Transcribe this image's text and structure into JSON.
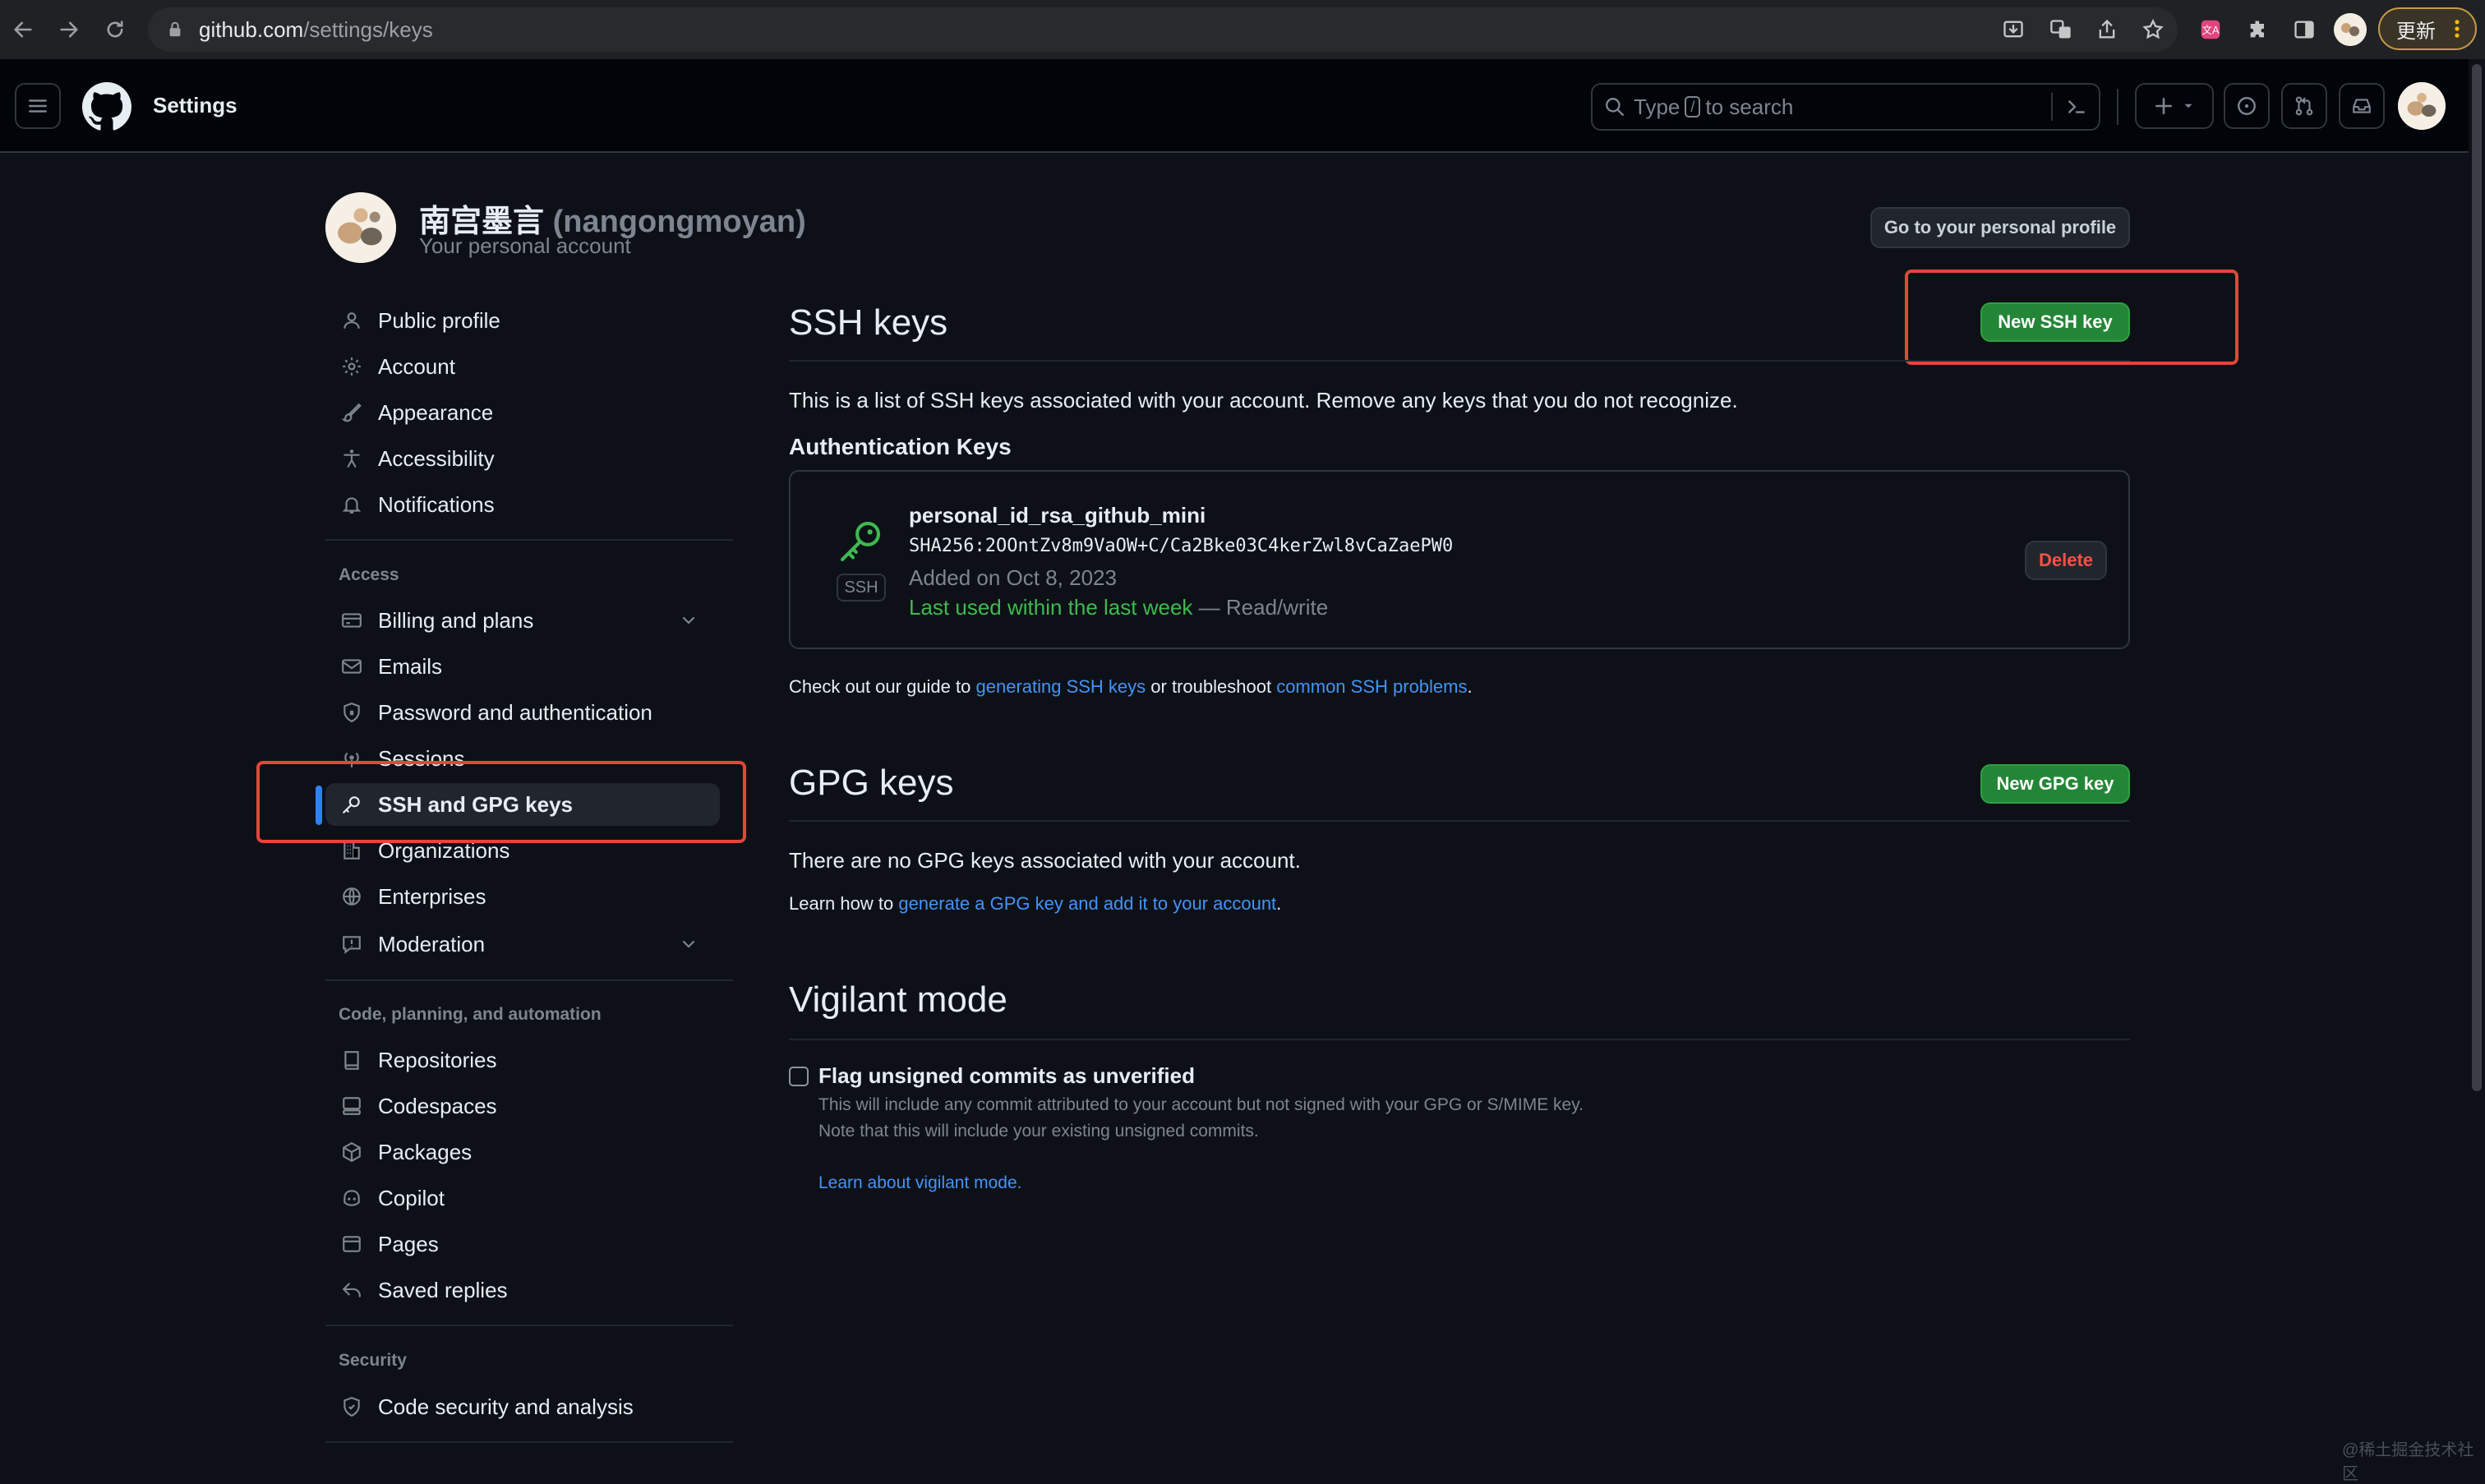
{
  "browser": {
    "url_host": "github.com",
    "url_path": "/settings/keys",
    "update_label": "更新"
  },
  "header": {
    "title": "Settings",
    "search_prefix": "Type",
    "search_key": "/",
    "search_suffix": "to search",
    "new_label": "+"
  },
  "profile": {
    "display_name": "南宫墨言",
    "login": "(nangongmoyan)",
    "subtitle": "Your personal account",
    "go_profile_label": "Go to your personal profile"
  },
  "sidebar": {
    "items": [
      {
        "label": "Public profile",
        "icon": "person-icon"
      },
      {
        "label": "Account",
        "icon": "gear-icon"
      },
      {
        "label": "Appearance",
        "icon": "paintbrush-icon"
      },
      {
        "label": "Accessibility",
        "icon": "accessibility-icon"
      },
      {
        "label": "Notifications",
        "icon": "bell-icon"
      }
    ],
    "access_heading": "Access",
    "access_items": [
      {
        "label": "Billing and plans",
        "icon": "credit-card-icon"
      },
      {
        "label": "Emails",
        "icon": "mail-icon"
      },
      {
        "label": "Password and authentication",
        "icon": "shield-lock-icon"
      },
      {
        "label": "Sessions",
        "icon": "broadcast-icon"
      },
      {
        "label": "SSH and GPG keys",
        "icon": "key-icon"
      },
      {
        "label": "Organizations",
        "icon": "organization-icon"
      },
      {
        "label": "Enterprises",
        "icon": "globe-icon"
      },
      {
        "label": "Moderation",
        "icon": "report-icon"
      }
    ],
    "code_heading": "Code, planning, and automation",
    "code_items": [
      {
        "label": "Repositories",
        "icon": "repo-icon"
      },
      {
        "label": "Codespaces",
        "icon": "codespaces-icon"
      },
      {
        "label": "Packages",
        "icon": "package-icon"
      },
      {
        "label": "Copilot",
        "icon": "copilot-icon"
      },
      {
        "label": "Pages",
        "icon": "browser-icon"
      },
      {
        "label": "Saved replies",
        "icon": "reply-icon"
      }
    ],
    "security_heading": "Security",
    "security_items": [
      {
        "label": "Code security and analysis",
        "icon": "shield-icon"
      }
    ]
  },
  "ssh": {
    "title": "SSH keys",
    "new_label": "New SSH key",
    "description": "This is a list of SSH keys associated with your account. Remove any keys that you do not recognize.",
    "auth_heading": "Authentication Keys",
    "key": {
      "title": "personal_id_rsa_github_mini",
      "fingerprint": "SHA256:2OOntZv8m9VaOW+C/Ca2Bke03C4kerZwl8vCaZaePW0",
      "added": "Added on Oct 8, 2023",
      "last_used": "Last used within the last week",
      "access": "— Read/write",
      "badge": "SSH",
      "delete_label": "Delete"
    },
    "guide_prefix": "Check out our guide to",
    "guide_link1": "generating SSH keys",
    "guide_mid": "or troubleshoot",
    "guide_link2": "common SSH problems",
    "guide_suffix": "."
  },
  "gpg": {
    "title": "GPG keys",
    "new_label": "New GPG key",
    "empty": "There are no GPG keys associated with your account.",
    "learn_prefix": "Learn how to",
    "learn_link": "generate a GPG key and add it to your account",
    "learn_suffix": "."
  },
  "vigilant": {
    "title": "Vigilant mode",
    "checkbox_label": "Flag unsigned commits as unverified",
    "desc1": "This will include any commit attributed to your account but not signed with your GPG or S/MIME key.",
    "desc2": "Note that this will include your existing unsigned commits.",
    "learn_link": "Learn about vigilant mode."
  },
  "watermark": "@稀土掘金技术社区",
  "colors": {
    "bg": "#0d1117",
    "accent_green": "#238636",
    "link": "#4493f8",
    "danger": "#f85149",
    "highlight_red": "#e5453a",
    "active_bar": "#2f81f7"
  }
}
